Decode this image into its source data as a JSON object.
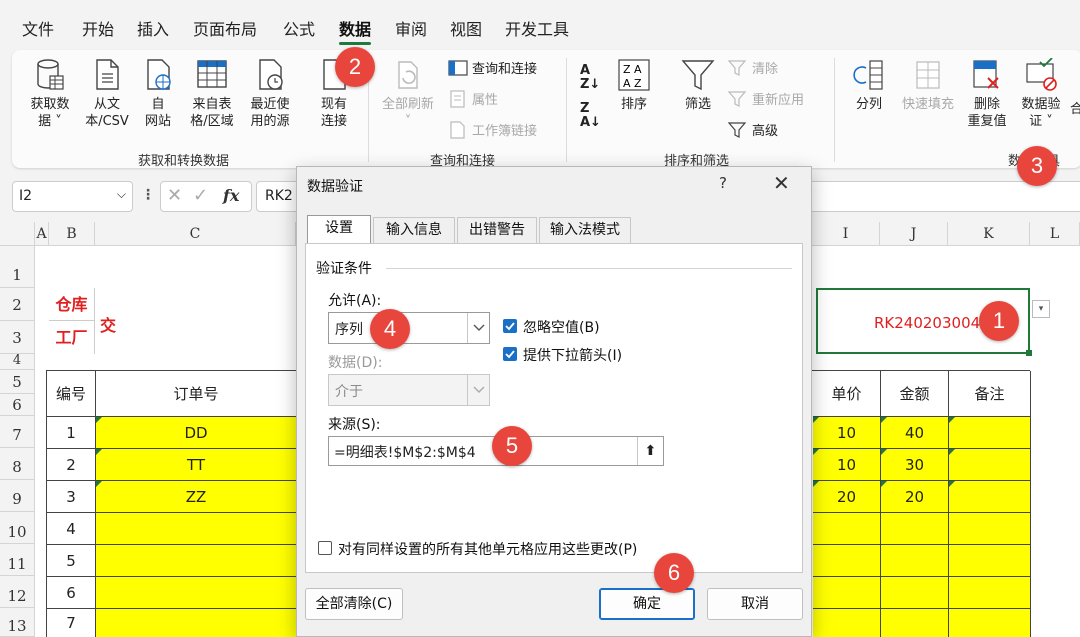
{
  "menu": [
    "文件",
    "开始",
    "插入",
    "页面布局",
    "公式",
    "数据",
    "审阅",
    "视图",
    "开发工具"
  ],
  "ribbon": {
    "get_data": {
      "l1": "获取数",
      "l2": "据 ˅"
    },
    "from_text": {
      "l1": "从文",
      "l2": "本/CSV"
    },
    "from_web": {
      "l1": "自",
      "l2": "网站"
    },
    "from_table": {
      "l1": "来自表",
      "l2": "格/区域"
    },
    "recent": {
      "l1": "最近使",
      "l2": "用的源"
    },
    "existing": {
      "l1": "现有",
      "l2": "连接"
    },
    "refresh_all": {
      "l1": "全部刷新",
      "l2": "˅"
    },
    "query_conn": "查询和连接",
    "properties": "属性",
    "workbook_links": "工作簿链接",
    "sort": "排序",
    "filter": "筛选",
    "clear": "清除",
    "reapply": "重新应用",
    "advanced": "高级",
    "split": "分列",
    "flash_fill": "快速填充",
    "remove_dup": {
      "l1": "删除",
      "l2": "重复值"
    },
    "data_validation": {
      "l1": "数据验",
      "l2": "证 ˅"
    },
    "more": "合",
    "groups": {
      "get_transform": "获取和转换数据",
      "queries": "查询和连接",
      "sort_filter": "排序和筛选",
      "data_tools": "数据工具"
    }
  },
  "formula_bar": {
    "name_box": "I2",
    "fx": "fx",
    "value": "RK2"
  },
  "columns": [
    "A",
    "B",
    "C",
    "I",
    "J",
    "K",
    "L"
  ],
  "rows": [
    "1",
    "2",
    "3",
    "4",
    "5",
    "6",
    "7",
    "8",
    "9",
    "10",
    "11",
    "12",
    "13"
  ],
  "sheet": {
    "warehouse": "仓库",
    "factory": "工厂",
    "deliver": "交",
    "receipt_no": "RK240203004",
    "headers": {
      "no": "编号",
      "order": "订单号",
      "price": "单价",
      "amount": "金额",
      "remark": "备注"
    },
    "table_rows": [
      {
        "no": "1",
        "order": "DD",
        "price": "10",
        "amount": "40"
      },
      {
        "no": "2",
        "order": "TT",
        "price": "10",
        "amount": "30"
      },
      {
        "no": "3",
        "order": "ZZ",
        "price": "20",
        "amount": "20"
      },
      {
        "no": "4",
        "order": "",
        "price": "",
        "amount": ""
      },
      {
        "no": "5",
        "order": "",
        "price": "",
        "amount": ""
      },
      {
        "no": "6",
        "order": "",
        "price": "",
        "amount": ""
      },
      {
        "no": "7",
        "order": "",
        "price": "",
        "amount": ""
      }
    ]
  },
  "dialog": {
    "title": "数据验证",
    "help": "?",
    "close": "✕",
    "tabs": [
      "设置",
      "输入信息",
      "出错警告",
      "输入法模式"
    ],
    "section": "验证条件",
    "allow_label": "允许(A):",
    "allow_value": "序列",
    "data_label": "数据(D):",
    "data_value": "介于",
    "ignore_blank": "忽略空值(B)",
    "dropdown_arrow": "提供下拉箭头(I)",
    "source_label": "来源(S):",
    "source_value": "=明细表!$M$2:$M$4",
    "apply_all": "对有同样设置的所有其他单元格应用这些更改(P)",
    "clear_all": "全部清除(C)",
    "ok": "确定",
    "cancel": "取消"
  },
  "badges": [
    "1",
    "2",
    "3",
    "4",
    "5",
    "6"
  ],
  "colors": {
    "accent": "#1f7a3a",
    "badge": "#e8463c",
    "check": "#1a6fc7",
    "highlight": "#ffff00",
    "red_text": "#e02020"
  }
}
